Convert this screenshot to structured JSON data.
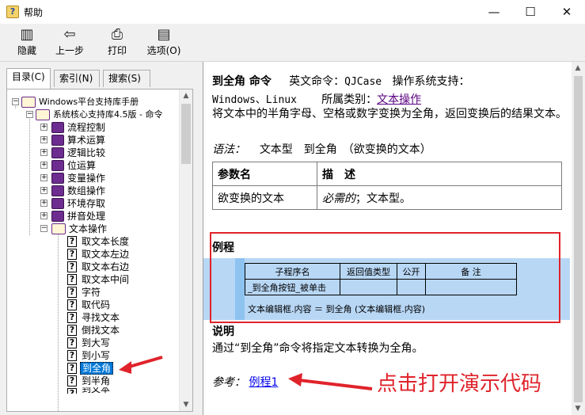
{
  "window": {
    "title": "帮助",
    "minimize": "—",
    "maximize": "☐",
    "close": "✕"
  },
  "toolbar": {
    "hide": "隐藏",
    "back": "上一步",
    "print": "打印",
    "options": "选项(O)",
    "hide_icon": "hide-icon",
    "back_icon": "arrow-left-icon",
    "print_icon": "printer-icon",
    "options_icon": "options-icon"
  },
  "tabs": [
    {
      "label": "目录(C)"
    },
    {
      "label": "索引(N)"
    },
    {
      "label": "搜索(S)"
    }
  ],
  "tree": {
    "root": "Windows平台支持库手册",
    "lib": "系统核心支持库4.5版 - 命令",
    "categories": [
      "流程控制",
      "算术运算",
      "逻辑比较",
      "位运算",
      "变量操作",
      "数组操作",
      "环境存取",
      "拼音处理"
    ],
    "open_category": "文本操作",
    "items": [
      "取文本长度",
      "取文本左边",
      "取文本右边",
      "取文本中间",
      "字符",
      "取代码",
      "寻找文本",
      "倒找文本",
      "到大写",
      "到小写",
      "到全角",
      "到半角",
      "到文本"
    ],
    "selected": "到全角"
  },
  "content": {
    "cmd_name": "到全角 命令",
    "en_label": "英文命令：",
    "en_name": "QJCase",
    "os_label": "操作系统支持：",
    "os_value": "Windows、Linux",
    "cat_label": "所属类别：",
    "cat_link": "文本操作",
    "description": "将文本中的半角字母、空格或数字变换为全角，返回变换后的结果文本。",
    "syntax_label": "语法：",
    "syntax": "文本型　到全角　（欲变换的文本）",
    "param_header": [
      "参数名",
      "描　述"
    ],
    "param_name": "欲变换的文本",
    "param_req": "必需的",
    "param_type": "；文本型。",
    "example_title": "例程",
    "example_table": {
      "headers": [
        "子程序名",
        "返回值类型",
        "公开",
        "备 注"
      ],
      "row": [
        "_到全角按钮_被单击",
        "",
        "",
        ""
      ]
    },
    "example_code": "文本编辑框.内容 ＝ 到全角 (文本编辑框.内容)",
    "note_title": "说明",
    "note_text": "通过“到全角”命令将指定文本转换为全角。",
    "ref_label": "参考：",
    "ref_link": "例程1"
  },
  "annotation": {
    "text": "点击打开演示代码",
    "color": "#e0232b"
  }
}
